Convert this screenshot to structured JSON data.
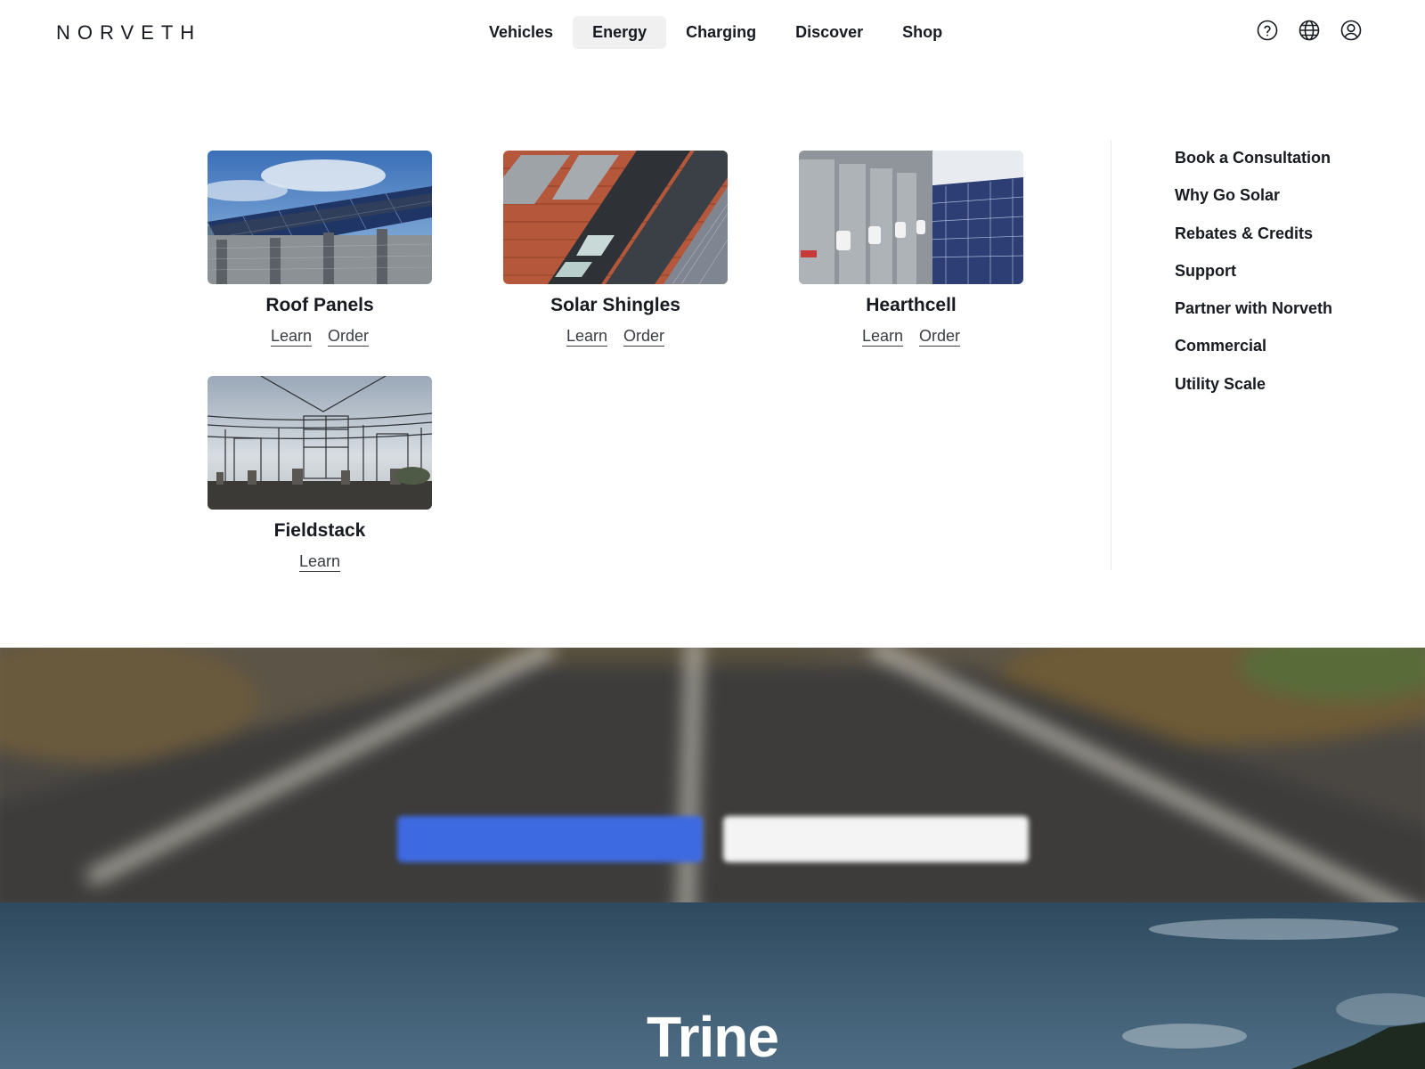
{
  "header": {
    "logo": "NORVETH",
    "nav": [
      {
        "label": "Vehicles"
      },
      {
        "label": "Energy"
      },
      {
        "label": "Charging"
      },
      {
        "label": "Discover"
      },
      {
        "label": "Shop"
      }
    ],
    "active_nav": "Energy",
    "icons": [
      "help-icon",
      "globe-icon",
      "account-icon"
    ]
  },
  "energy_menu": {
    "products": [
      {
        "title": "Roof Panels",
        "learn": "Learn",
        "order": "Order",
        "image": "solar-panels-on-roof-photo"
      },
      {
        "title": "Solar Shingles",
        "learn": "Learn",
        "order": "Order",
        "image": "solar-shingle-roof-photo"
      },
      {
        "title": "Hearthcell",
        "learn": "Learn",
        "order": "Order",
        "image": "battery-units-solar-field-photo"
      },
      {
        "title": "Fieldstack",
        "learn": "Learn",
        "image": "electrical-substation-photo"
      }
    ],
    "side_links": [
      "Book a Consultation",
      "Why Go Solar",
      "Rebates & Credits",
      "Support",
      "Partner with Norveth",
      "Commercial",
      "Utility Scale"
    ]
  },
  "hero": {
    "primary_button": "",
    "secondary_button": ""
  },
  "next_section": {
    "title": "Trine"
  },
  "colors": {
    "text": "#171a20",
    "active_nav_bg": "#f0f0f0",
    "primary_button": "#3e6ae1",
    "secondary_button": "#f4f4f4"
  }
}
